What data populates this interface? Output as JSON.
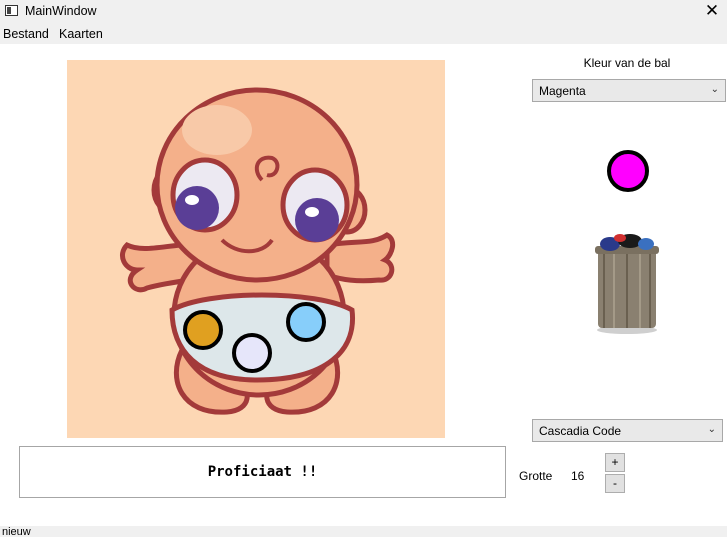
{
  "window": {
    "title": "MainWindow",
    "close_glyph": "✕"
  },
  "menu": {
    "items": [
      "Bestand",
      "Kaarten"
    ]
  },
  "canvas": {
    "background": "#fdd7b4",
    "balls": [
      {
        "name": "ball-gold",
        "color": "#e0a020"
      },
      {
        "name": "ball-lavender",
        "color": "#e6e6fa"
      },
      {
        "name": "ball-lightblue",
        "color": "#87cefa"
      }
    ]
  },
  "side": {
    "ball_color_label": "Kleur van de bal",
    "color_combo": {
      "value": "Magenta",
      "chevron": "⌄"
    },
    "preview_ball_color": "#ff00ff",
    "trash_icon": "trash-can-icon",
    "font_combo": {
      "value": "Cascadia Code",
      "chevron": "⌄"
    },
    "size_label": "Grotte",
    "size_value": "16",
    "plus": "+",
    "minus": "-"
  },
  "message": {
    "text": "Proficiaat !!"
  },
  "status": {
    "text": "nieuw"
  }
}
